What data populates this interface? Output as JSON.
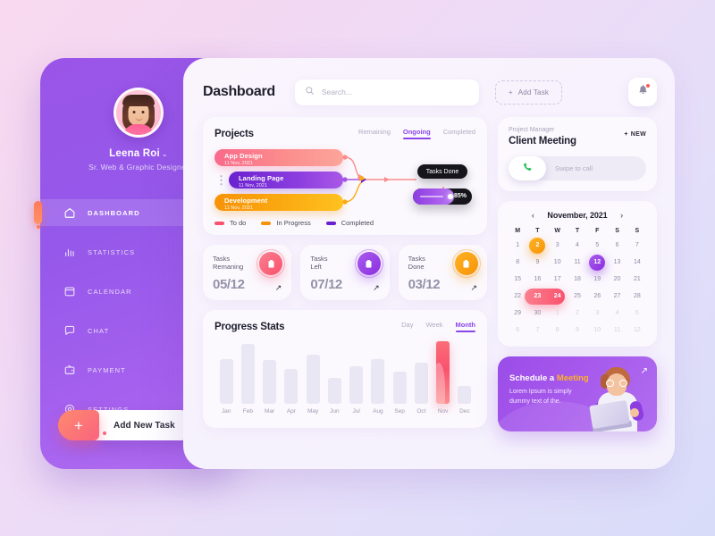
{
  "sidebar": {
    "user": {
      "name": "Leena Roi",
      "chevron": "⌄",
      "role": "Sr. Web & Graphic Designer",
      "avatar_icon": "user-avatar"
    },
    "items": [
      {
        "label": "DASHBOARD",
        "icon": "home-icon",
        "active": true
      },
      {
        "label": "STATISTICS",
        "icon": "chart-bar-icon",
        "active": false
      },
      {
        "label": "CALENDAR",
        "icon": "calendar-icon",
        "active": false
      },
      {
        "label": "CHAT",
        "icon": "chat-bubble-icon",
        "active": false
      },
      {
        "label": "PAYMENT",
        "icon": "wallet-icon",
        "active": false
      },
      {
        "label": "SETTINGS",
        "icon": "gear-icon",
        "active": false
      }
    ],
    "add_task": {
      "label": "Add New Task",
      "plus": "+"
    }
  },
  "header": {
    "title": "Dashboard",
    "search": {
      "placeholder": "Search...",
      "value": "",
      "icon": "search-icon"
    },
    "add_task_button": {
      "label": "Add Task",
      "plus": "+"
    },
    "bell": {
      "icon": "bell-icon",
      "has_badge": true
    }
  },
  "projects": {
    "title": "Projects",
    "tabs": [
      {
        "label": "Remaining",
        "active": false
      },
      {
        "label": "Ongoing",
        "active": true
      },
      {
        "label": "Completed",
        "active": false
      }
    ],
    "items": [
      {
        "name": "App Design",
        "date": "11 Nov, 2021",
        "status": "To do"
      },
      {
        "name": "Landing Page",
        "date": "11 Nov, 2021",
        "status": "Completed"
      },
      {
        "name": "Development",
        "date": "11 Nov, 2021",
        "status": "In Progress"
      }
    ],
    "tasks_done_label": "Tasks Done",
    "progress_value": "85%",
    "legend": [
      {
        "label": "To do",
        "color": "#f9526e"
      },
      {
        "label": "In Progress",
        "color": "#f79308"
      },
      {
        "label": "Completed",
        "color": "#6a21cf"
      }
    ]
  },
  "stats": [
    {
      "label_line1": "Tasks",
      "label_line2": "Remaning",
      "value": "05/12",
      "icon": "clipboard-icon",
      "arrow": "↗"
    },
    {
      "label_line1": "Tasks",
      "label_line2": "Left",
      "value": "07/12",
      "icon": "clipboard-icon",
      "arrow": "↗"
    },
    {
      "label_line1": "Tasks",
      "label_line2": "Done",
      "value": "03/12",
      "icon": "clipboard-icon",
      "arrow": "↗"
    }
  ],
  "progress_stats": {
    "title": "Progress Stats",
    "tabs": [
      {
        "label": "Day",
        "active": false
      },
      {
        "label": "Week",
        "active": false
      },
      {
        "label": "Month",
        "active": true
      }
    ]
  },
  "chart_data": {
    "type": "bar",
    "title": "Progress Stats",
    "xlabel": "",
    "ylabel": "",
    "ylim": [
      0,
      100
    ],
    "grid": false,
    "legend": "none",
    "categories": [
      "Jan",
      "Feb",
      "Mar",
      "Apr",
      "May",
      "Jun",
      "Jul",
      "Aug",
      "Sep",
      "Oct",
      "Nov",
      "Dec"
    ],
    "values": [
      72,
      95,
      70,
      55,
      78,
      42,
      60,
      72,
      52,
      66,
      100,
      28
    ],
    "highlight_index": 10,
    "highlight_color": "#f9526e",
    "bar_color": "#e9e7f3"
  },
  "meeting": {
    "subtitle": "Project Manager",
    "title": "Client Meeting",
    "new_button": {
      "label": "NEW",
      "plus": "+"
    },
    "swipe": {
      "text": "Swipe to call",
      "icon": "phone-icon"
    }
  },
  "calendar": {
    "month": "November, 2021",
    "prev": "‹",
    "next": "›",
    "dow": [
      "M",
      "T",
      "W",
      "T",
      "F",
      "S",
      "S"
    ],
    "weeks": [
      [
        {
          "d": "1",
          "s": "normal"
        },
        {
          "d": "2",
          "s": "orange"
        },
        {
          "d": "3",
          "s": "normal"
        },
        {
          "d": "4",
          "s": "normal"
        },
        {
          "d": "5",
          "s": "normal"
        },
        {
          "d": "6",
          "s": "normal"
        },
        {
          "d": "7",
          "s": "normal"
        }
      ],
      [
        {
          "d": "8",
          "s": "normal"
        },
        {
          "d": "9",
          "s": "normal"
        },
        {
          "d": "10",
          "s": "normal"
        },
        {
          "d": "11",
          "s": "normal"
        },
        {
          "d": "12",
          "s": "purple"
        },
        {
          "d": "13",
          "s": "normal"
        },
        {
          "d": "14",
          "s": "normal"
        }
      ],
      [
        {
          "d": "15",
          "s": "normal"
        },
        {
          "d": "16",
          "s": "normal"
        },
        {
          "d": "17",
          "s": "normal"
        },
        {
          "d": "18",
          "s": "normal"
        },
        {
          "d": "19",
          "s": "normal"
        },
        {
          "d": "20",
          "s": "normal"
        },
        {
          "d": "21",
          "s": "normal"
        }
      ],
      [
        {
          "d": "22",
          "s": "normal"
        },
        {
          "d": "23",
          "s": "range"
        },
        {
          "d": "24",
          "s": "range"
        },
        {
          "d": "25",
          "s": "normal"
        },
        {
          "d": "26",
          "s": "normal"
        },
        {
          "d": "27",
          "s": "normal"
        },
        {
          "d": "28",
          "s": "normal"
        }
      ],
      [
        {
          "d": "29",
          "s": "normal"
        },
        {
          "d": "30",
          "s": "normal"
        },
        {
          "d": "1",
          "s": "muted"
        },
        {
          "d": "2",
          "s": "muted"
        },
        {
          "d": "3",
          "s": "muted"
        },
        {
          "d": "4",
          "s": "muted"
        },
        {
          "d": "5",
          "s": "muted"
        }
      ],
      [
        {
          "d": "6",
          "s": "muted"
        },
        {
          "d": "7",
          "s": "muted"
        },
        {
          "d": "8",
          "s": "muted"
        },
        {
          "d": "9",
          "s": "muted"
        },
        {
          "d": "10",
          "s": "muted"
        },
        {
          "d": "11",
          "s": "muted"
        },
        {
          "d": "12",
          "s": "muted"
        }
      ]
    ]
  },
  "promo": {
    "title_part1": "Schedule a ",
    "title_highlight": "Meeting",
    "subtitle": "Lorem Ipsum is simply dummy text of the.",
    "arrow": "↗",
    "illustration": "person-with-laptop-illustration"
  }
}
